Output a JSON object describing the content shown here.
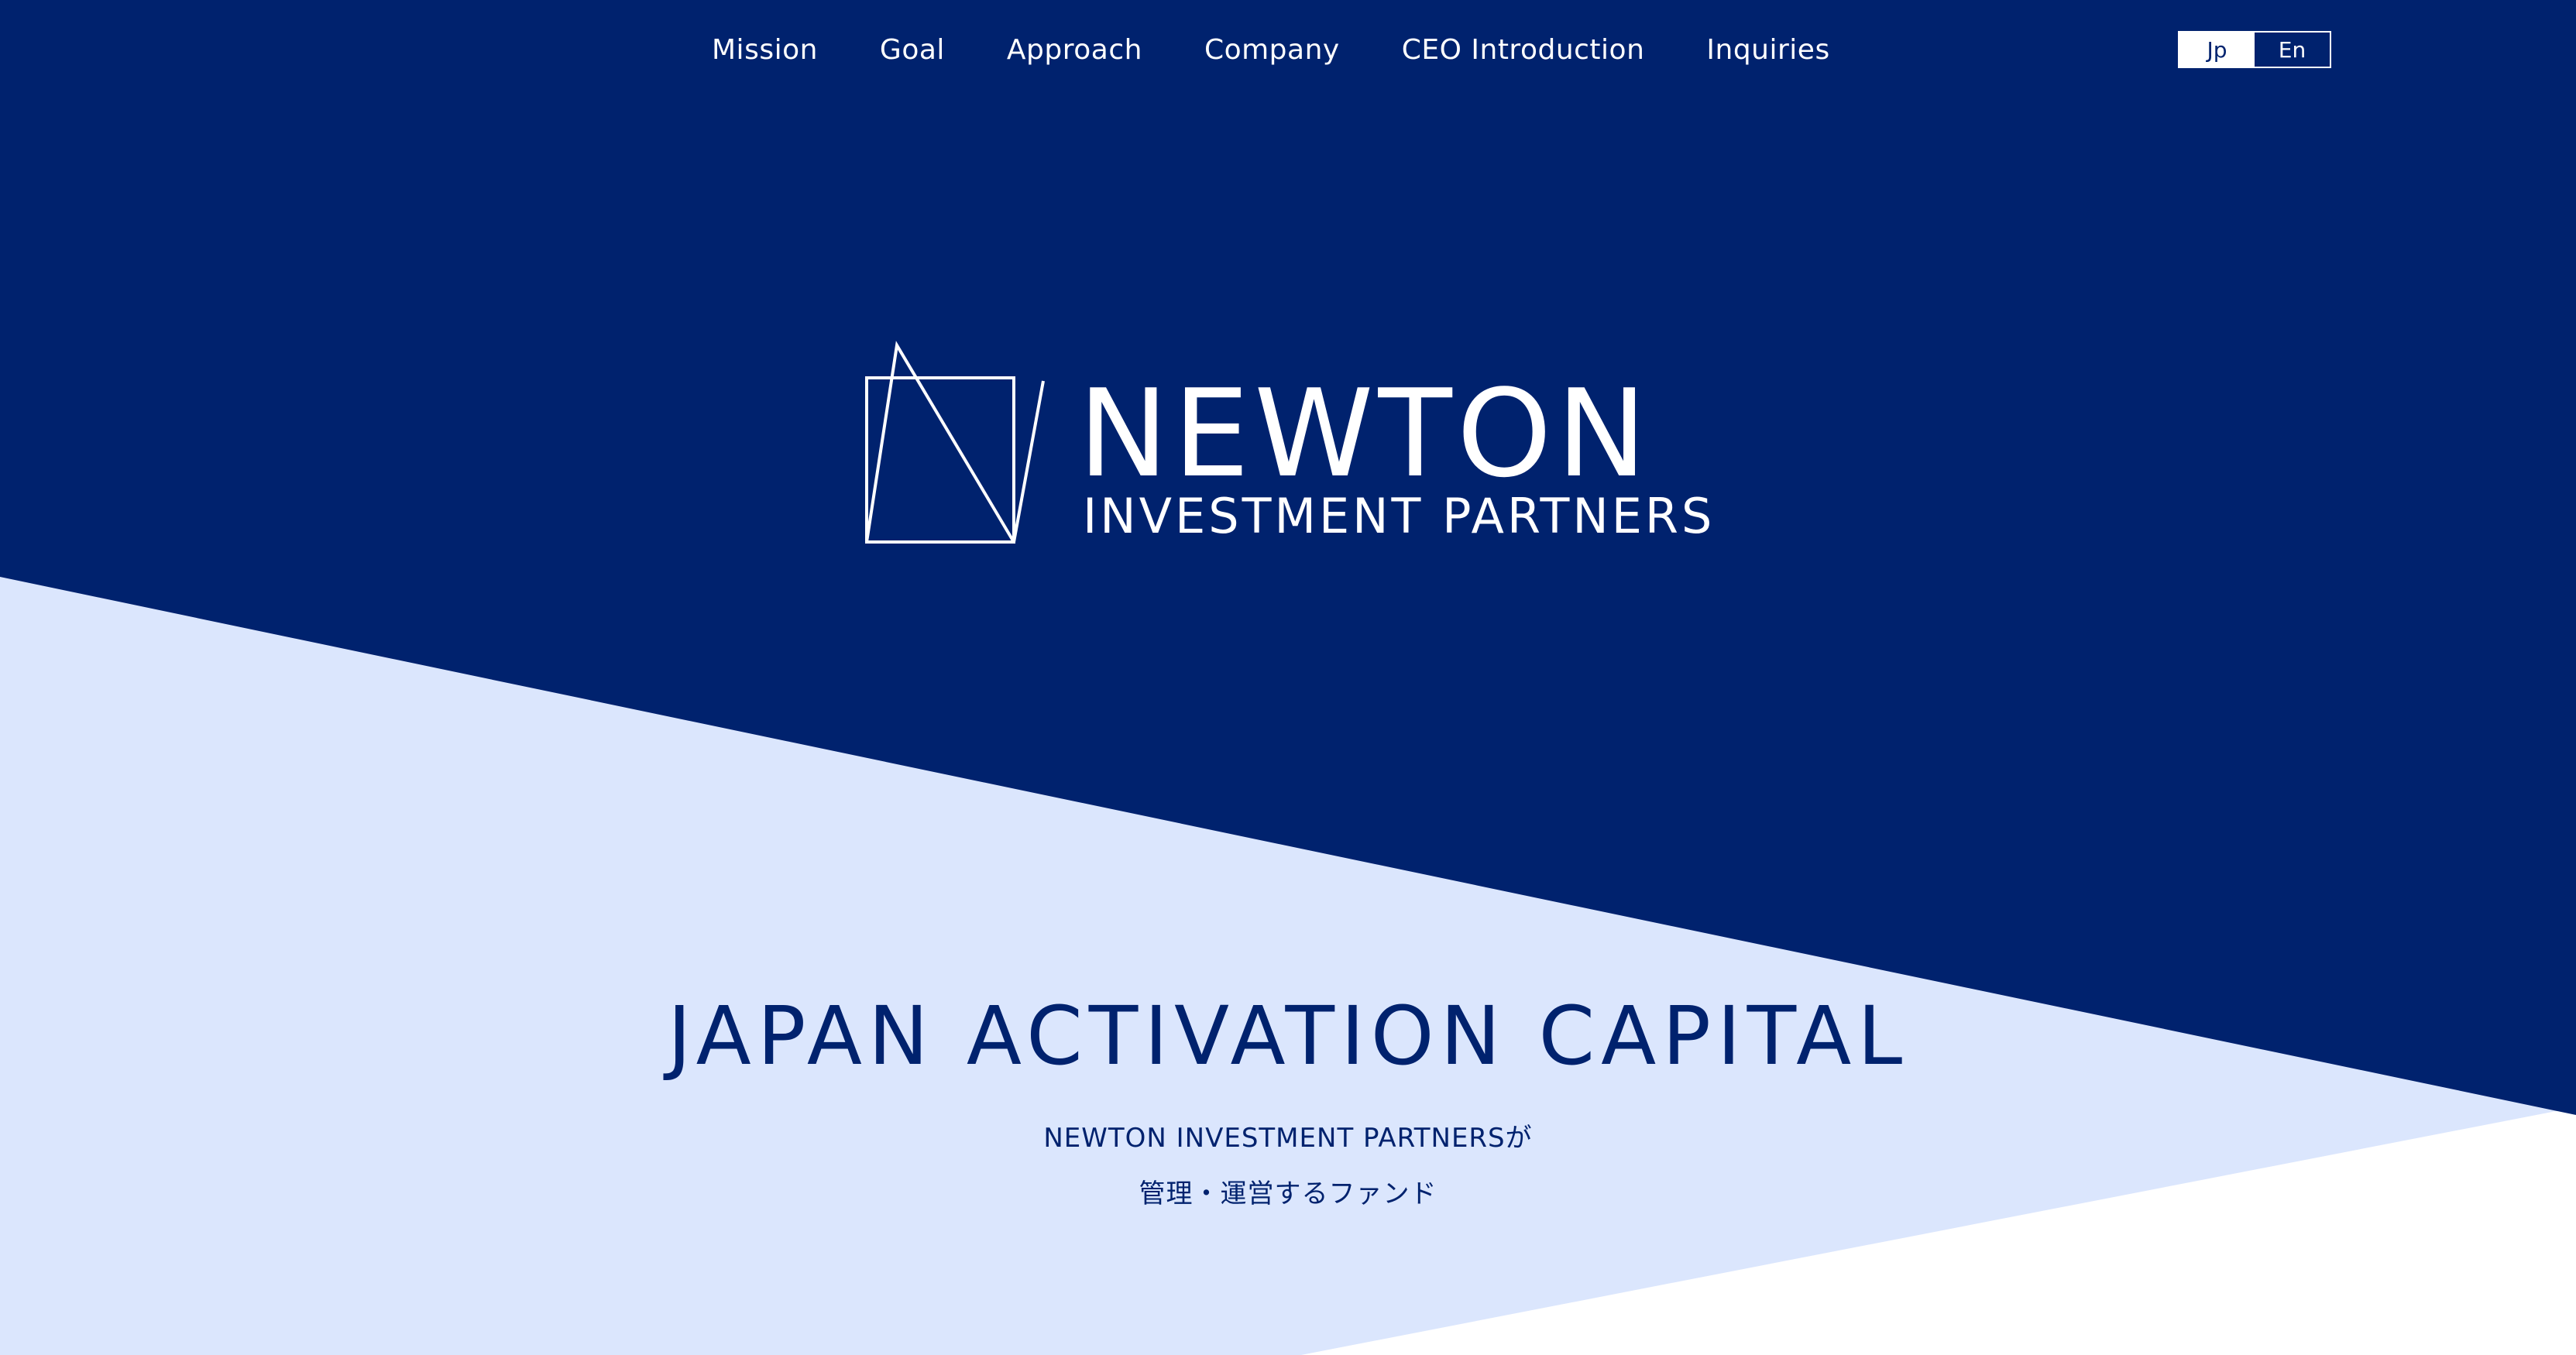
{
  "colors": {
    "navy": "#00226e",
    "light_blue": "#dbe6fd",
    "white": "#ffffff"
  },
  "nav": {
    "items": [
      {
        "label": "Mission"
      },
      {
        "label": "Goal"
      },
      {
        "label": "Approach"
      },
      {
        "label": "Company"
      },
      {
        "label": "CEO Introduction"
      },
      {
        "label": "Inquiries"
      }
    ]
  },
  "language": {
    "options": [
      "Jp",
      "En"
    ],
    "selected": "Jp"
  },
  "logo": {
    "wordmark": "NEWTON",
    "subtitle": "INVESTMENT PARTNERS",
    "icon": "square-triangle-logo-icon"
  },
  "fund": {
    "title": "JAPAN ACTIVATION CAPITAL",
    "description_line1": "NEWTON INVESTMENT PARTNERSが",
    "description_line2": "管理・運営するファンド"
  }
}
